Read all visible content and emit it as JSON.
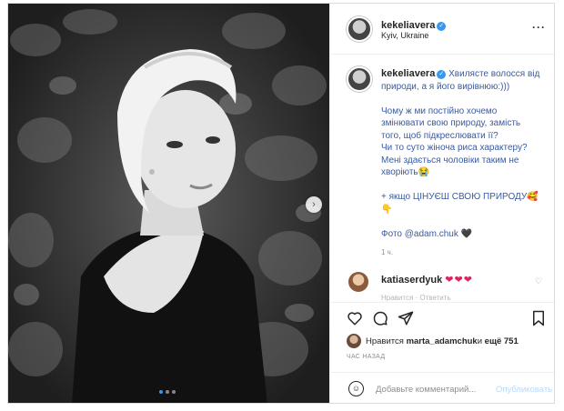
{
  "post": {
    "username": "kekeliavera",
    "location": "Kyiv, Ukraine",
    "more_icon": "more-icon",
    "caption_lines": [
      "Хвилясте волосся від",
      "природи, а я його вирівнюю:)))"
    ],
    "caption_body": [
      "Чому ж ми постійно хочемо",
      "змінювати свою природу, замість",
      "того, щоб підкреслювати її?",
      "Чи то суто жіноча риса характеру?",
      "Мені здається чоловіки таким не",
      "хворіють😭"
    ],
    "caption_tail": "+ якщо ЦІНУЄШ СВОЮ ПРИРОДУ🥰",
    "caption_tail2": "👇",
    "photo_credit": "Фото @adam.chuk 🖤",
    "caption_time": "1 ч.",
    "carousel_dots": 3,
    "carousel_active": 0
  },
  "comment": {
    "username": "katiaserdyuk",
    "text": "❤❤❤",
    "faded_text": "Нравится · Ответить"
  },
  "likes": {
    "prefix": "Нравится ",
    "user": "marta_adamchuk",
    "middle": " и ",
    "count": "ещё 751"
  },
  "post_time": "ЧАС НАЗАД",
  "add_comment": {
    "placeholder": "Добавьте комментарий...",
    "publish_label": "Опубликовать"
  },
  "colors": {
    "verified": "#3897f0",
    "heart": "#e0245e",
    "publish_disabled": "#b3dbff"
  }
}
